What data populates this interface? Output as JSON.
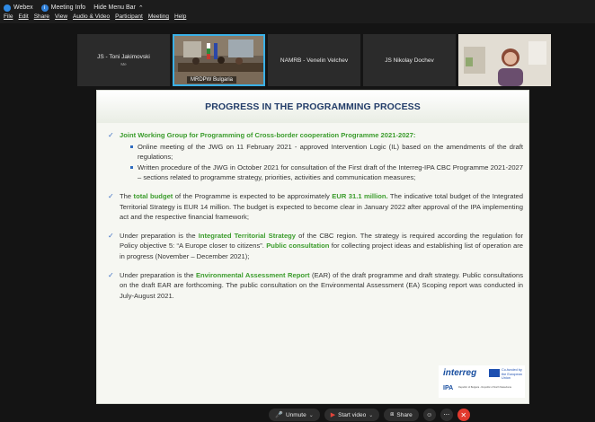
{
  "topbar": {
    "app_name": "Webex",
    "meeting_info": "Meeting Info",
    "hide_menu": "Hide Menu Bar",
    "menu": [
      "File",
      "Edit",
      "Share",
      "View",
      "Audio & Video",
      "Participant",
      "Meeting",
      "Help"
    ]
  },
  "tiles": [
    {
      "name": "JS - Toni Jakimovski",
      "sub": "Me"
    },
    {
      "name": "MRDPW Bulgaria"
    },
    {
      "name": "NAMRB - Venelin Velchev"
    },
    {
      "name": "JS Nikolay Dochev"
    }
  ],
  "slide": {
    "title": "PROGRESS IN THE PROGRAMMING PROCESS",
    "b1_title": "Joint Working Group for Programming of Cross-border cooperation Programme 2021-2027:",
    "b1_s1": "Online meeting of the JWG on 11 February 2021 - approved Intervention Logic (IL) based on the amendments of the draft regulations;",
    "b1_s2": "Written procedure of the JWG in October 2021 for consultation of the First draft of the Interreg-IPA CBC Programme 2021-2027 – sections related to programme strategy, priorities, activities and communication measures;",
    "b2_a": "The ",
    "b2_hl1": "total budget",
    "b2_b": " of the Programme is expected to be approximately ",
    "b2_hl2": "EUR 31.1 million.",
    "b2_c": " The indicative total budget of the Integrated Territorial Strategy is EUR 14 million. The budget is expected to become clear in January 2022 after approval of the IPA implementing act and the respective financial framework;",
    "b3_a": "Under preparation is the ",
    "b3_hl1": "Integrated Territorial Strategy",
    "b3_b": " of the CBC region. The strategy is required according the regulation for Policy objective 5: “A Europe closer to citizens”. ",
    "b3_hl2": "Public consultation",
    "b3_c": " for collecting project ideas and establishing list of operation are in progress (November – December 2021);",
    "b4_a": "Under preparation is the ",
    "b4_hl1": "Environmental Assessment Report",
    "b4_b": " (EAR) of the draft programme and draft strategy. Public consultations on the draft EAR are forthcoming. The public consultation on the Environmental Assessment (EA) Scoping report was conducted in July-August 2021.",
    "logo_interreg": "interreg",
    "logo_eu": "Co-funded by the European Union",
    "logo_ipa": "IPA",
    "logo_ipa_small": "Republic of Bulgaria - Republic of North Macedonia"
  },
  "controls": {
    "unmute": "Unmute",
    "start_video": "Start video",
    "share": "Share"
  }
}
